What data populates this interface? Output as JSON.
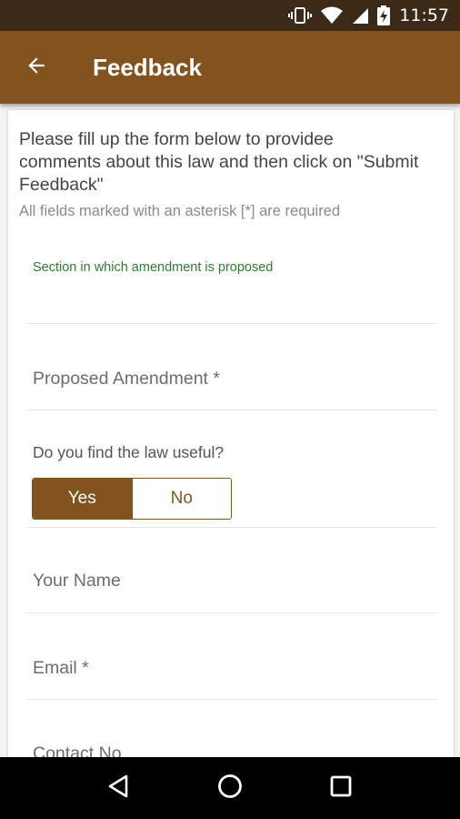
{
  "status_bar": {
    "time": "11:57"
  },
  "app_bar": {
    "title": "Feedback"
  },
  "form": {
    "intro": "Please fill up the form below to providee comments about this law and then click on \"Submit Feedback\"",
    "required_note": "All fields marked with an asterisk [*] are required",
    "section_label": "Section in which amendment is proposed",
    "proposed_amendment_placeholder": "Proposed Amendment *",
    "question": "Do you find the law useful?",
    "toggle": {
      "yes_label": "Yes",
      "no_label": "No",
      "selected": "Yes"
    },
    "name_placeholder": "Your Name",
    "email_placeholder": "Email *",
    "contact_placeholder": "Contact No"
  },
  "colors": {
    "primary": "#82531f",
    "status_bar": "#3a2a17",
    "section_label": "#2e7d32"
  },
  "icons": {
    "status": [
      "vibrate-icon",
      "wifi-icon",
      "signal-icon",
      "battery-charging-icon"
    ],
    "back": "back-arrow-icon",
    "nav": [
      "nav-back-icon",
      "nav-home-icon",
      "nav-recents-icon"
    ]
  }
}
